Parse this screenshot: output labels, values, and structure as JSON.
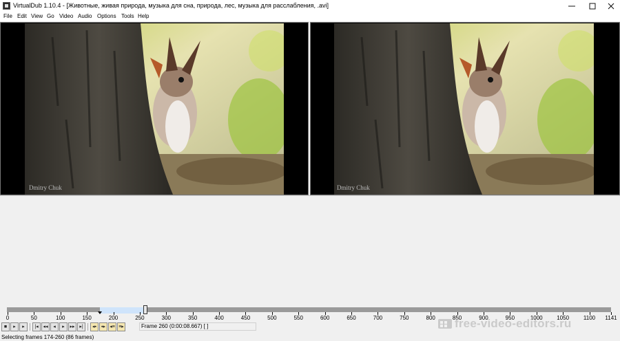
{
  "window": {
    "title": "VirtualDub 1.10.4 - [Животные, живая природа, музыка для сна, природа, лес, музыка для расслабления, .avi]",
    "minimize_icon": "minimize-icon",
    "maximize_icon": "maximize-icon",
    "close_icon": "close-icon"
  },
  "menu": [
    "File",
    "Edit",
    "View",
    "Go",
    "Video",
    "Audio",
    "Options",
    "Tools",
    "Help"
  ],
  "panes": {
    "input_watermark": "Dmitry Chuk",
    "output_watermark": "Dmitry Chuk"
  },
  "timeline": {
    "ticks": [
      "0",
      "50",
      "100",
      "150",
      "200",
      "250",
      "300",
      "350",
      "400",
      "450",
      "500",
      "550",
      "600",
      "650",
      "700",
      "750",
      "800",
      "850",
      "900",
      "950",
      "1000",
      "1050",
      "1100",
      "1141"
    ],
    "tick_values": [
      0,
      50,
      100,
      150,
      200,
      250,
      300,
      350,
      400,
      450,
      500,
      550,
      600,
      650,
      700,
      750,
      800,
      850,
      900,
      950,
      1000,
      1050,
      1100,
      1141
    ],
    "total_frames": 1141,
    "selection_start": 174,
    "selection_end": 260,
    "current_frame": 260,
    "selection_color": "#cfe4fb"
  },
  "toolbar": {
    "buttons": [
      "stop-icon",
      "play-input-icon",
      "play-output-icon",
      "start-icon",
      "prev-key-icon",
      "prev-frame-icon",
      "next-frame-icon",
      "next-key-icon",
      "end-icon",
      "mark-in-icon",
      "mark-out-icon",
      "scene-back-icon",
      "scene-fwd-icon"
    ],
    "frame_info": "Frame 260 (0:00:08.667) [ ]"
  },
  "status": {
    "text": "Selecting frames 174-260 (86 frames)"
  },
  "watermark": {
    "text": "free-video-editors.ru"
  }
}
